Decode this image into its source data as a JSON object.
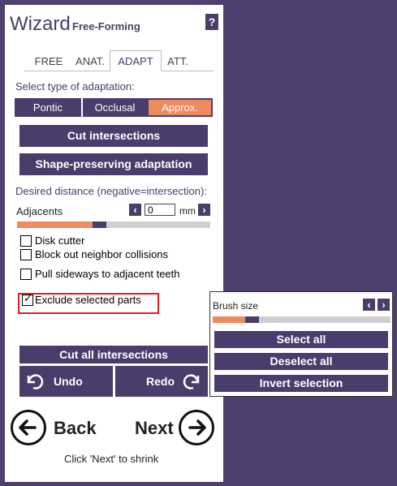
{
  "header": {
    "title": "Wizard",
    "subtitle": "Free-Forming",
    "help": "?"
  },
  "tabs": [
    {
      "label": "FREE"
    },
    {
      "label": "ANAT."
    },
    {
      "label": "ADAPT",
      "active": true
    },
    {
      "label": "ATT."
    }
  ],
  "adaptation": {
    "label": "Select type of adaptation:",
    "options": [
      "Pontic",
      "Occlusal",
      "Approx."
    ],
    "selected": "Approx."
  },
  "actions": {
    "cut_intersections": "Cut intersections",
    "shape_preserving": "Shape-preserving adaptation"
  },
  "distance": {
    "label": "Desired distance (negative=intersection):",
    "adjacents_label": "Adjacents",
    "value": "0",
    "unit": "mm",
    "slider_fraction": 0.42
  },
  "checkboxes": [
    {
      "label": "Disk cutter",
      "checked": false
    },
    {
      "label": "Block out neighbor collisions",
      "checked": false
    },
    {
      "label": "Pull sideways to adjacent teeth",
      "checked": false
    },
    {
      "label": "Exclude selected parts",
      "checked": true
    }
  ],
  "bottom": {
    "cut_all": "Cut all intersections",
    "undo": "Undo",
    "redo": "Redo",
    "back": "Back",
    "next": "Next",
    "hint": "Click 'Next' to shrink"
  },
  "popup": {
    "brush_label": "Brush size",
    "brush_fraction": 0.2,
    "select_all": "Select all",
    "deselect_all": "Deselect all",
    "invert": "Invert selection"
  },
  "colors": {
    "primary": "#4a3d6b",
    "accent": "#ef8a5e",
    "background": "#4f3f6e",
    "highlight": "#e02020"
  }
}
